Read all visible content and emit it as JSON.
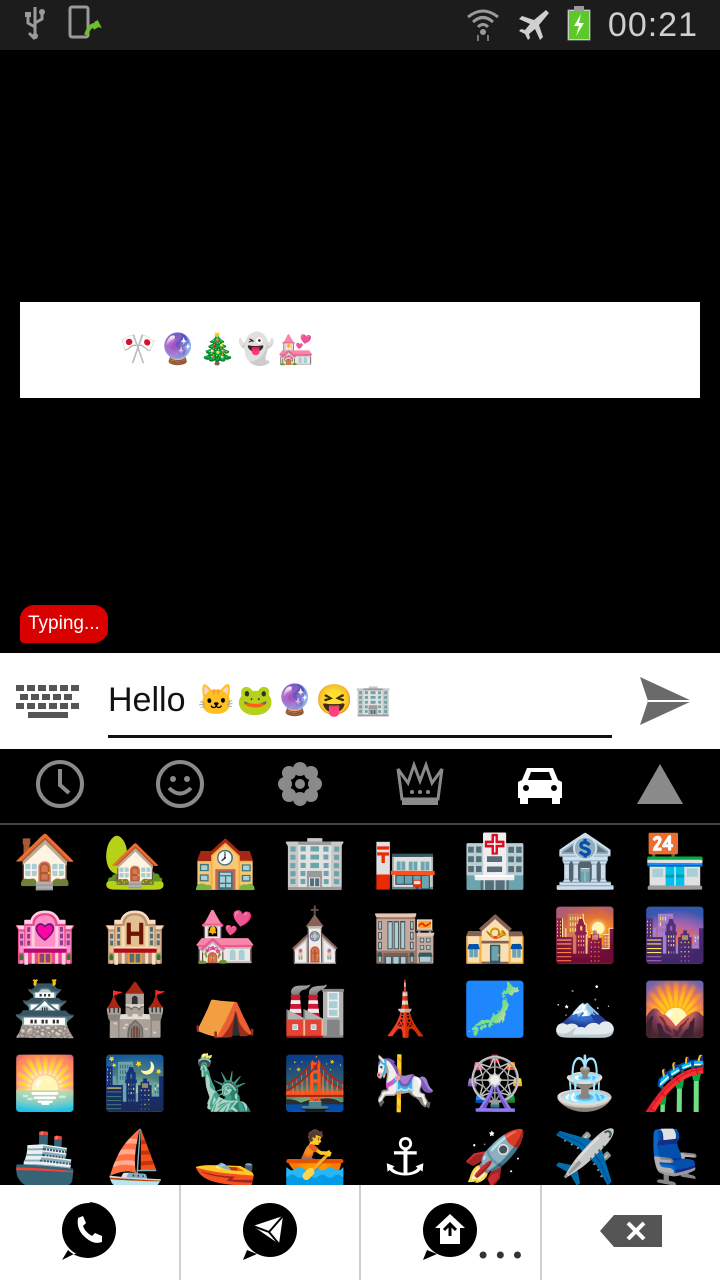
{
  "status_bar": {
    "time": "00:21",
    "icons": [
      "usb-icon",
      "phone-update-icon",
      "wifi-icon",
      "airplane-icon",
      "battery-charging-icon"
    ]
  },
  "chat": {
    "sent_emojis": [
      "😝",
      "😄",
      "😛",
      "🎌",
      "🔮",
      "🎄",
      "👻",
      "💒"
    ],
    "typing_label": "Typing..."
  },
  "input": {
    "text": "Hello",
    "emojis": [
      "🐱",
      "🐸",
      "🔮",
      "😝",
      "🏢"
    ]
  },
  "tabs": [
    {
      "name": "tab-recent",
      "icon": "clock-icon"
    },
    {
      "name": "tab-faces",
      "icon": "smiley-icon"
    },
    {
      "name": "tab-nature",
      "icon": "flower-icon"
    },
    {
      "name": "tab-objects",
      "icon": "crown-icon"
    },
    {
      "name": "tab-places",
      "icon": "car-icon",
      "active": true
    },
    {
      "name": "tab-symbols",
      "icon": "triangle-icon"
    }
  ],
  "emoji_grid": [
    "🏠",
    "🏡",
    "🏫",
    "🏢",
    "🏣",
    "🏥",
    "🏦",
    "🏪",
    "🏩",
    "🏨",
    "💒",
    "⛪",
    "🏬",
    "🏤",
    "🌇",
    "🌆",
    "🏯",
    "🏰",
    "⛺",
    "🏭",
    "🗼",
    "🗾",
    "🗻",
    "🌄",
    "🌅",
    "🌃",
    "🗽",
    "🌉",
    "🎠",
    "🎡",
    "⛲",
    "🎢",
    "🚢",
    "⛵",
    "🚤",
    "🚣",
    "⚓",
    "🚀",
    "✈️",
    "💺"
  ],
  "bottom_nav": [
    "phone-icon",
    "mail-icon",
    "home-icon",
    "backspace-icon"
  ],
  "colors": {
    "typing_bubble": "#d90000",
    "status_bar": "#1c1c1c",
    "tab_inactive": "#8a8a8a"
  }
}
